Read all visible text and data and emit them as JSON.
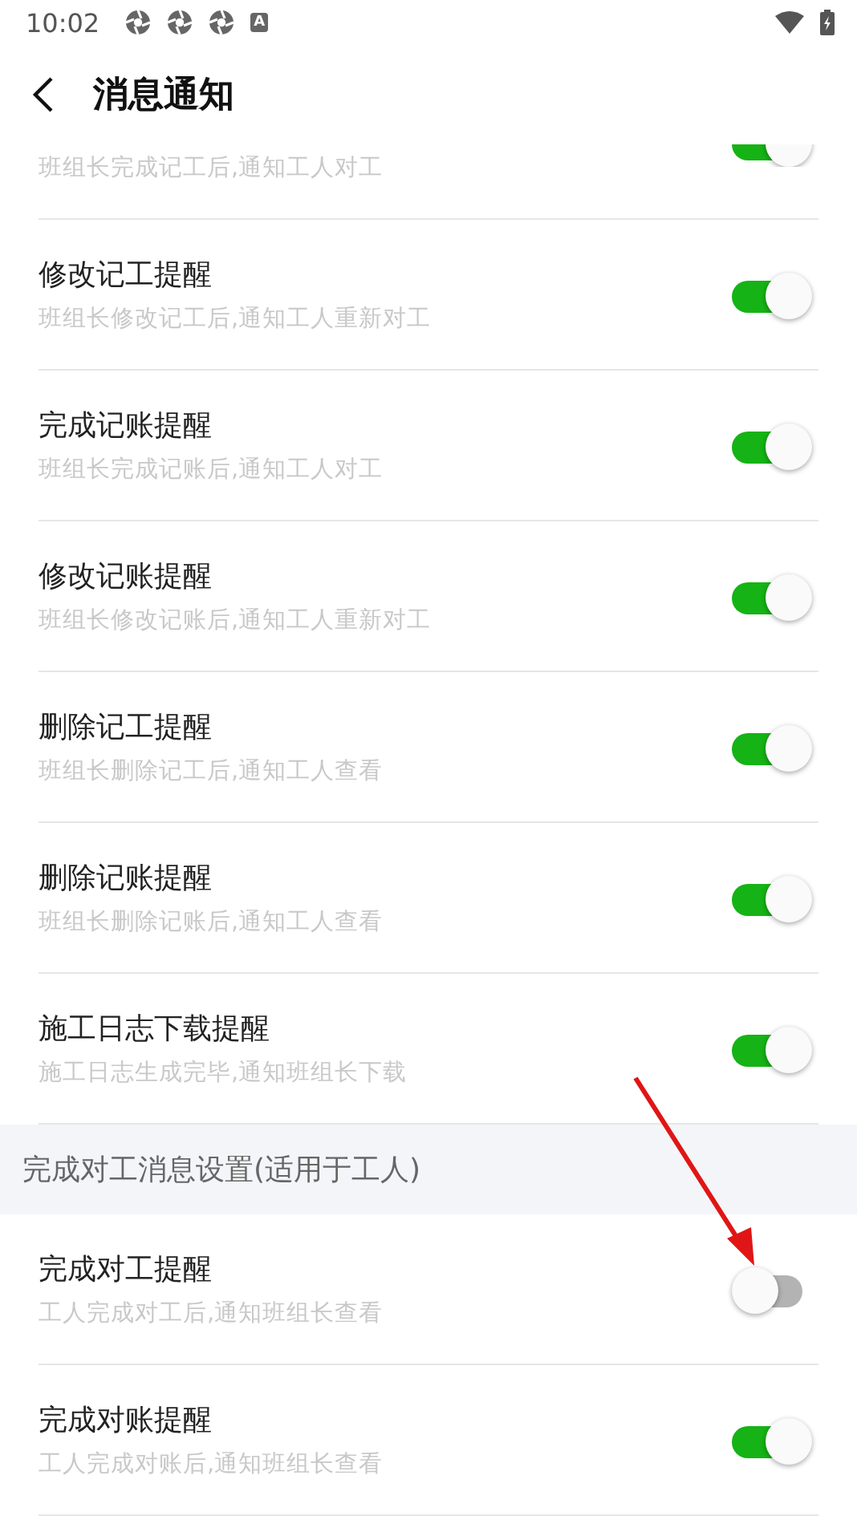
{
  "status_bar": {
    "time": "10:02",
    "badge": "A"
  },
  "header": {
    "title": "消息通知"
  },
  "groups": [
    {
      "items": [
        {
          "kind": "partial",
          "subtitle": "班组长完成记工后,通知工人对工",
          "on": true
        },
        {
          "kind": "full",
          "title": "修改记工提醒",
          "subtitle": "班组长修改记工后,通知工人重新对工",
          "on": true
        },
        {
          "kind": "full",
          "title": "完成记账提醒",
          "subtitle": "班组长完成记账后,通知工人对工",
          "on": true
        },
        {
          "kind": "full",
          "title": "修改记账提醒",
          "subtitle": "班组长修改记账后,通知工人重新对工",
          "on": true
        },
        {
          "kind": "full",
          "title": "删除记工提醒",
          "subtitle": "班组长删除记工后,通知工人查看",
          "on": true
        },
        {
          "kind": "full",
          "title": "删除记账提醒",
          "subtitle": "班组长删除记账后,通知工人查看",
          "on": true
        },
        {
          "kind": "full",
          "title": "施工日志下载提醒",
          "subtitle": "施工日志生成完毕,通知班组长下载",
          "on": true
        }
      ]
    },
    {
      "heading": "完成对工消息设置(适用于工人)",
      "items": [
        {
          "kind": "full",
          "title": "完成对工提醒",
          "subtitle": "工人完成对工后,通知班组长查看",
          "on": false
        },
        {
          "kind": "full",
          "title": "完成对账提醒",
          "subtitle": "工人完成对账后,通知班组长查看",
          "on": true
        }
      ]
    }
  ]
}
